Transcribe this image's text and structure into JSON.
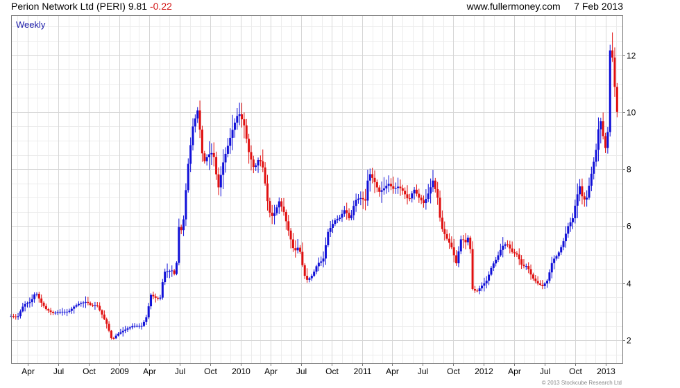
{
  "header": {
    "security": "Perion Network Ltd (PERI)",
    "price": "9.81",
    "change": "-0.22",
    "site": "www.fullermoney.com",
    "date": "7 Feb 2013"
  },
  "copyright": "© 2013 Stockcube Research Ltd",
  "colors": {
    "up": "#1010d8",
    "down": "#e01010",
    "grid": "#d6d6d6",
    "frame": "#7a7a7a"
  },
  "chart_data": {
    "type": "candlestick",
    "period_label": "Weekly",
    "y_axis": {
      "position": "right",
      "ticks": [
        2,
        4,
        6,
        8,
        10,
        12
      ],
      "range": [
        1.2,
        13.4
      ]
    },
    "x_axis": {
      "range": [
        "2008-02-11",
        "2013-02-20"
      ],
      "ticks": [
        {
          "date": "2008-04-01",
          "label": "Apr"
        },
        {
          "date": "2008-07-01",
          "label": "Jul"
        },
        {
          "date": "2008-10-01",
          "label": "Oct"
        },
        {
          "date": "2009-01-01",
          "label": "2009"
        },
        {
          "date": "2009-04-01",
          "label": "Apr"
        },
        {
          "date": "2009-07-01",
          "label": "Jul"
        },
        {
          "date": "2009-10-01",
          "label": "Oct"
        },
        {
          "date": "2010-01-01",
          "label": "2010"
        },
        {
          "date": "2010-04-01",
          "label": "Apr"
        },
        {
          "date": "2010-07-01",
          "label": "Jul"
        },
        {
          "date": "2010-10-01",
          "label": "Oct"
        },
        {
          "date": "2011-01-01",
          "label": "2011"
        },
        {
          "date": "2011-04-01",
          "label": "Apr"
        },
        {
          "date": "2011-07-01",
          "label": "Jul"
        },
        {
          "date": "2011-10-01",
          "label": "Oct"
        },
        {
          "date": "2012-01-01",
          "label": "2012"
        },
        {
          "date": "2012-04-01",
          "label": "Apr"
        },
        {
          "date": "2012-07-01",
          "label": "Jul"
        },
        {
          "date": "2012-10-01",
          "label": "Oct"
        },
        {
          "date": "2013-01-01",
          "label": "2013"
        }
      ]
    },
    "grid": true,
    "start_week": "2008-02-11",
    "week_step_days": 7,
    "close_path": [
      [
        "2008-02-11",
        2.85
      ],
      [
        "2008-03-01",
        2.8
      ],
      [
        "2008-03-20",
        3.25
      ],
      [
        "2008-04-10",
        3.35
      ],
      [
        "2008-04-25",
        3.7
      ],
      [
        "2008-05-10",
        3.35
      ],
      [
        "2008-05-25",
        3.1
      ],
      [
        "2008-06-15",
        2.95
      ],
      [
        "2008-07-10",
        3.0
      ],
      [
        "2008-08-01",
        3.0
      ],
      [
        "2008-08-20",
        3.2
      ],
      [
        "2008-09-05",
        3.3
      ],
      [
        "2008-09-25",
        3.35
      ],
      [
        "2008-10-10",
        3.2
      ],
      [
        "2008-10-25",
        3.25
      ],
      [
        "2008-11-10",
        2.9
      ],
      [
        "2008-11-25",
        2.55
      ],
      [
        "2008-12-10",
        2.0
      ],
      [
        "2008-12-25",
        2.2
      ],
      [
        "2009-01-15",
        2.35
      ],
      [
        "2009-02-10",
        2.5
      ],
      [
        "2009-03-10",
        2.5
      ],
      [
        "2009-03-25",
        2.85
      ],
      [
        "2009-04-05",
        3.6
      ],
      [
        "2009-04-25",
        3.45
      ],
      [
        "2009-05-05",
        3.5
      ],
      [
        "2009-05-15",
        4.4
      ],
      [
        "2009-06-10",
        4.45
      ],
      [
        "2009-06-20",
        4.2
      ],
      [
        "2009-06-27",
        6.0
      ],
      [
        "2009-07-10",
        5.8
      ],
      [
        "2009-07-25",
        8.0
      ],
      [
        "2009-08-10",
        9.5
      ],
      [
        "2009-08-25",
        10.1
      ],
      [
        "2009-09-10",
        8.2
      ],
      [
        "2009-09-25",
        8.5
      ],
      [
        "2009-10-10",
        8.6
      ],
      [
        "2009-10-25",
        7.3
      ],
      [
        "2009-11-10",
        8.3
      ],
      [
        "2009-11-25",
        8.9
      ],
      [
        "2009-12-10",
        9.5
      ],
      [
        "2009-12-25",
        10.0
      ],
      [
        "2010-01-10",
        9.6
      ],
      [
        "2010-01-25",
        8.6
      ],
      [
        "2010-02-10",
        8.0
      ],
      [
        "2010-02-25",
        8.4
      ],
      [
        "2010-03-10",
        8.0
      ],
      [
        "2010-03-20",
        7.0
      ],
      [
        "2010-04-01",
        6.3
      ],
      [
        "2010-04-15",
        6.5
      ],
      [
        "2010-04-25",
        6.9
      ],
      [
        "2010-05-10",
        6.5
      ],
      [
        "2010-05-25",
        5.8
      ],
      [
        "2010-06-10",
        5.1
      ],
      [
        "2010-06-25",
        5.3
      ],
      [
        "2010-07-10",
        4.3
      ],
      [
        "2010-07-20",
        4.1
      ],
      [
        "2010-08-05",
        4.3
      ],
      [
        "2010-08-20",
        4.7
      ],
      [
        "2010-09-05",
        4.8
      ],
      [
        "2010-09-20",
        5.8
      ],
      [
        "2010-10-10",
        6.2
      ],
      [
        "2010-10-25",
        6.3
      ],
      [
        "2010-11-10",
        6.6
      ],
      [
        "2010-11-25",
        6.2
      ],
      [
        "2010-12-10",
        6.9
      ],
      [
        "2010-12-25",
        7.0
      ],
      [
        "2011-01-10",
        6.9
      ],
      [
        "2011-01-20",
        7.9
      ],
      [
        "2011-02-05",
        7.6
      ],
      [
        "2011-02-20",
        7.2
      ],
      [
        "2011-03-05",
        7.3
      ],
      [
        "2011-03-20",
        7.5
      ],
      [
        "2011-04-05",
        7.3
      ],
      [
        "2011-04-20",
        7.4
      ],
      [
        "2011-05-05",
        7.2
      ],
      [
        "2011-05-20",
        6.9
      ],
      [
        "2011-06-05",
        7.3
      ],
      [
        "2011-06-20",
        7.0
      ],
      [
        "2011-07-05",
        6.8
      ],
      [
        "2011-07-20",
        7.2
      ],
      [
        "2011-08-01",
        7.6
      ],
      [
        "2011-08-15",
        7.0
      ],
      [
        "2011-08-25",
        6.0
      ],
      [
        "2011-09-10",
        5.6
      ],
      [
        "2011-09-25",
        5.3
      ],
      [
        "2011-10-10",
        4.7
      ],
      [
        "2011-10-25",
        5.6
      ],
      [
        "2011-11-10",
        5.4
      ],
      [
        "2011-11-18",
        5.8
      ],
      [
        "2011-11-28",
        3.8
      ],
      [
        "2011-12-10",
        3.7
      ],
      [
        "2011-12-25",
        3.9
      ],
      [
        "2012-01-10",
        4.1
      ],
      [
        "2012-01-25",
        4.6
      ],
      [
        "2012-02-10",
        4.9
      ],
      [
        "2012-02-25",
        5.3
      ],
      [
        "2012-03-10",
        5.4
      ],
      [
        "2012-03-25",
        5.1
      ],
      [
        "2012-04-10",
        5.0
      ],
      [
        "2012-04-25",
        4.6
      ],
      [
        "2012-05-10",
        4.6
      ],
      [
        "2012-05-25",
        4.2
      ],
      [
        "2012-06-10",
        4.0
      ],
      [
        "2012-06-25",
        3.9
      ],
      [
        "2012-07-10",
        4.1
      ],
      [
        "2012-07-25",
        4.8
      ],
      [
        "2012-08-10",
        5.0
      ],
      [
        "2012-08-25",
        5.4
      ],
      [
        "2012-09-10",
        6.0
      ],
      [
        "2012-09-25",
        6.3
      ],
      [
        "2012-10-05",
        7.0
      ],
      [
        "2012-10-15",
        7.4
      ],
      [
        "2012-10-25",
        6.9
      ],
      [
        "2012-11-05",
        7.0
      ],
      [
        "2012-11-15",
        7.6
      ],
      [
        "2012-11-25",
        8.2
      ],
      [
        "2012-12-05",
        8.8
      ],
      [
        "2012-12-10",
        9.4
      ],
      [
        "2012-12-20",
        9.8
      ],
      [
        "2012-12-25",
        9.0
      ],
      [
        "2013-01-01",
        8.7
      ],
      [
        "2013-01-07",
        9.3
      ],
      [
        "2013-01-12",
        12.1
      ],
      [
        "2013-01-18",
        12.3
      ],
      [
        "2013-01-25",
        11.4
      ],
      [
        "2013-02-01",
        10.2
      ],
      [
        "2013-02-07",
        9.81
      ]
    ]
  }
}
